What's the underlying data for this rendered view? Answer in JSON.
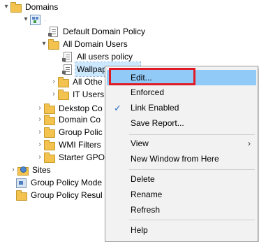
{
  "tree": {
    "domains": "Domains",
    "domain_name": ".",
    "default_domain_policy": "Default Domain Policy",
    "all_domain_users": "All Domain Users",
    "all_users_policy": "All users policy",
    "wallpaper_policy": "Wallpaper Policy",
    "all_other": "All Othe",
    "it_users": "IT Users",
    "desktop_computers": "Dekstop Co",
    "domain_controllers": "Domain Co",
    "group_policy_objects": "Group Polic",
    "wmi_filters": "WMI Filters",
    "starter_gpos": "Starter GPO",
    "sites": "Sites",
    "group_policy_modeling": "Group Policy Mode",
    "group_policy_results": "Group Policy Resul"
  },
  "context_menu": {
    "edit": "Edit...",
    "enforced": "Enforced",
    "link_enabled": "Link Enabled",
    "save_report": "Save Report...",
    "view": "View",
    "new_window": "New Window from Here",
    "delete": "Delete",
    "rename": "Rename",
    "refresh": "Refresh",
    "help": "Help"
  },
  "colors": {
    "highlight": "#91c9f7",
    "annotation_box": "#e01a24",
    "selection": "#cce8ff"
  },
  "icons": {
    "expanded": "chevron-down-icon",
    "collapsed": "chevron-right-icon",
    "check": "check-icon",
    "submenu": "submenu-arrow-icon"
  }
}
